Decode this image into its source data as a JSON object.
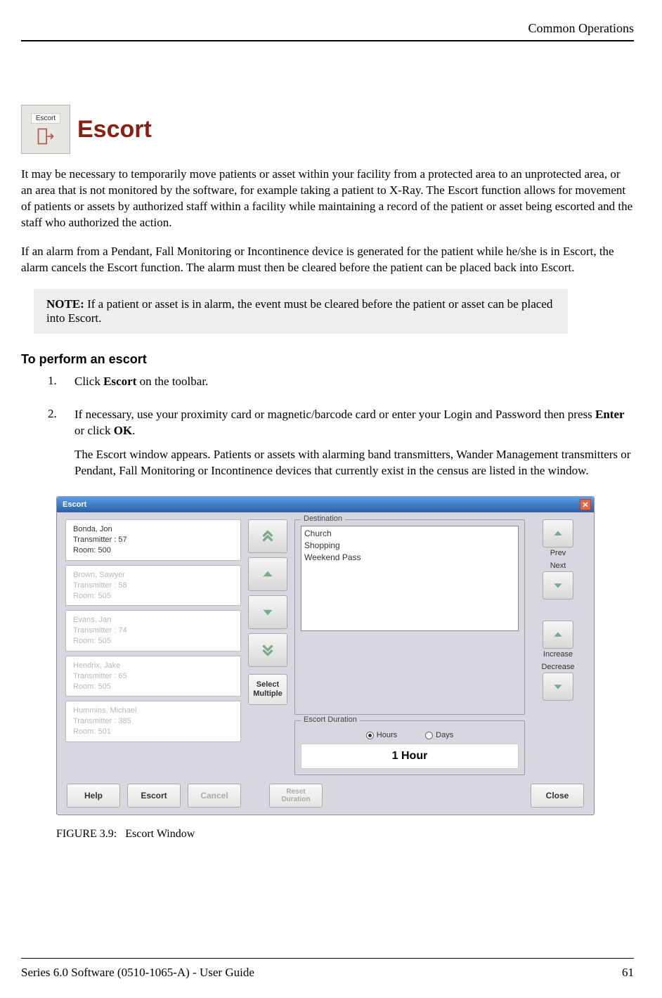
{
  "header": {
    "right": "Common Operations"
  },
  "section": {
    "icon_label": "Escort",
    "title": "Escort",
    "para1": "It may be necessary to temporarily move patients or asset within your facility from a protected area to an unprotected area, or an area that is not monitored by the software, for example taking a patient to X-Ray. The Escort function allows for movement of patients or assets by authorized staff within a facility while maintaining a record of the patient or asset being escorted and the staff who authorized the action.",
    "para2": "If an alarm from a Pendant, Fall Monitoring or Incontinence device is generated for the patient while he/she is in Escort, the alarm cancels the Escort function. The alarm must then be cleared before the patient can be placed back into Escort."
  },
  "note": {
    "label": "NOTE:",
    "text": " If a patient or asset is in alarm, the event must be cleared before the patient or asset can be placed into Escort."
  },
  "subhead": "To perform an escort",
  "steps": {
    "s1_num": "1.",
    "s1_a": "Click ",
    "s1_b": "Escort",
    "s1_c": " on the toolbar.",
    "s2_num": "2.",
    "s2_a": "If necessary, use your proximity card or magnetic/barcode card or enter your Login and Password then press ",
    "s2_b": "Enter",
    "s2_c": " or click ",
    "s2_d": "OK",
    "s2_e": ".",
    "s2_p2": "The Escort window appears. Patients or assets with alarming band transmitters, Wander Management transmitters or Pendant, Fall Monitoring or Incontinence devices that currently exist in the census are listed in the window."
  },
  "window": {
    "title": "Escort",
    "patients": [
      {
        "name": "Bonda, Jon",
        "tx": "Transmitter : 57",
        "room": "Room: 500"
      },
      {
        "name": "Brown, Sawyer",
        "tx": "Transmitter : 58",
        "room": "Room: 505"
      },
      {
        "name": "Evans, Jan",
        "tx": "Transmitter : 74",
        "room": "Room: 505"
      },
      {
        "name": "Hendrix, Jake",
        "tx": "Transmitter : 65",
        "room": "Room: 505"
      },
      {
        "name": "Hummins, Michael",
        "tx": "Transmitter : 385",
        "room": "Room: 501"
      }
    ],
    "select_multiple": "Select\nMultiple",
    "destination_label": "Destination",
    "destination_options": [
      "Church",
      "Shopping",
      "Weekend Pass"
    ],
    "duration_label": "Escort Duration",
    "radio_hours": "Hours",
    "radio_days": "Days",
    "duration_value": "1 Hour",
    "prev": "Prev",
    "next": "Next",
    "increase": "Increase",
    "decrease": "Decrease",
    "help": "Help",
    "escort_btn": "Escort",
    "cancel": "Cancel",
    "reset": "Reset\nDuration",
    "close": "Close"
  },
  "figure": {
    "num": "FIGURE 3.9:",
    "title": "Escort Window"
  },
  "footer": {
    "left": "Series 6.0 Software (0510-1065-A) - User Guide",
    "right": "61"
  }
}
